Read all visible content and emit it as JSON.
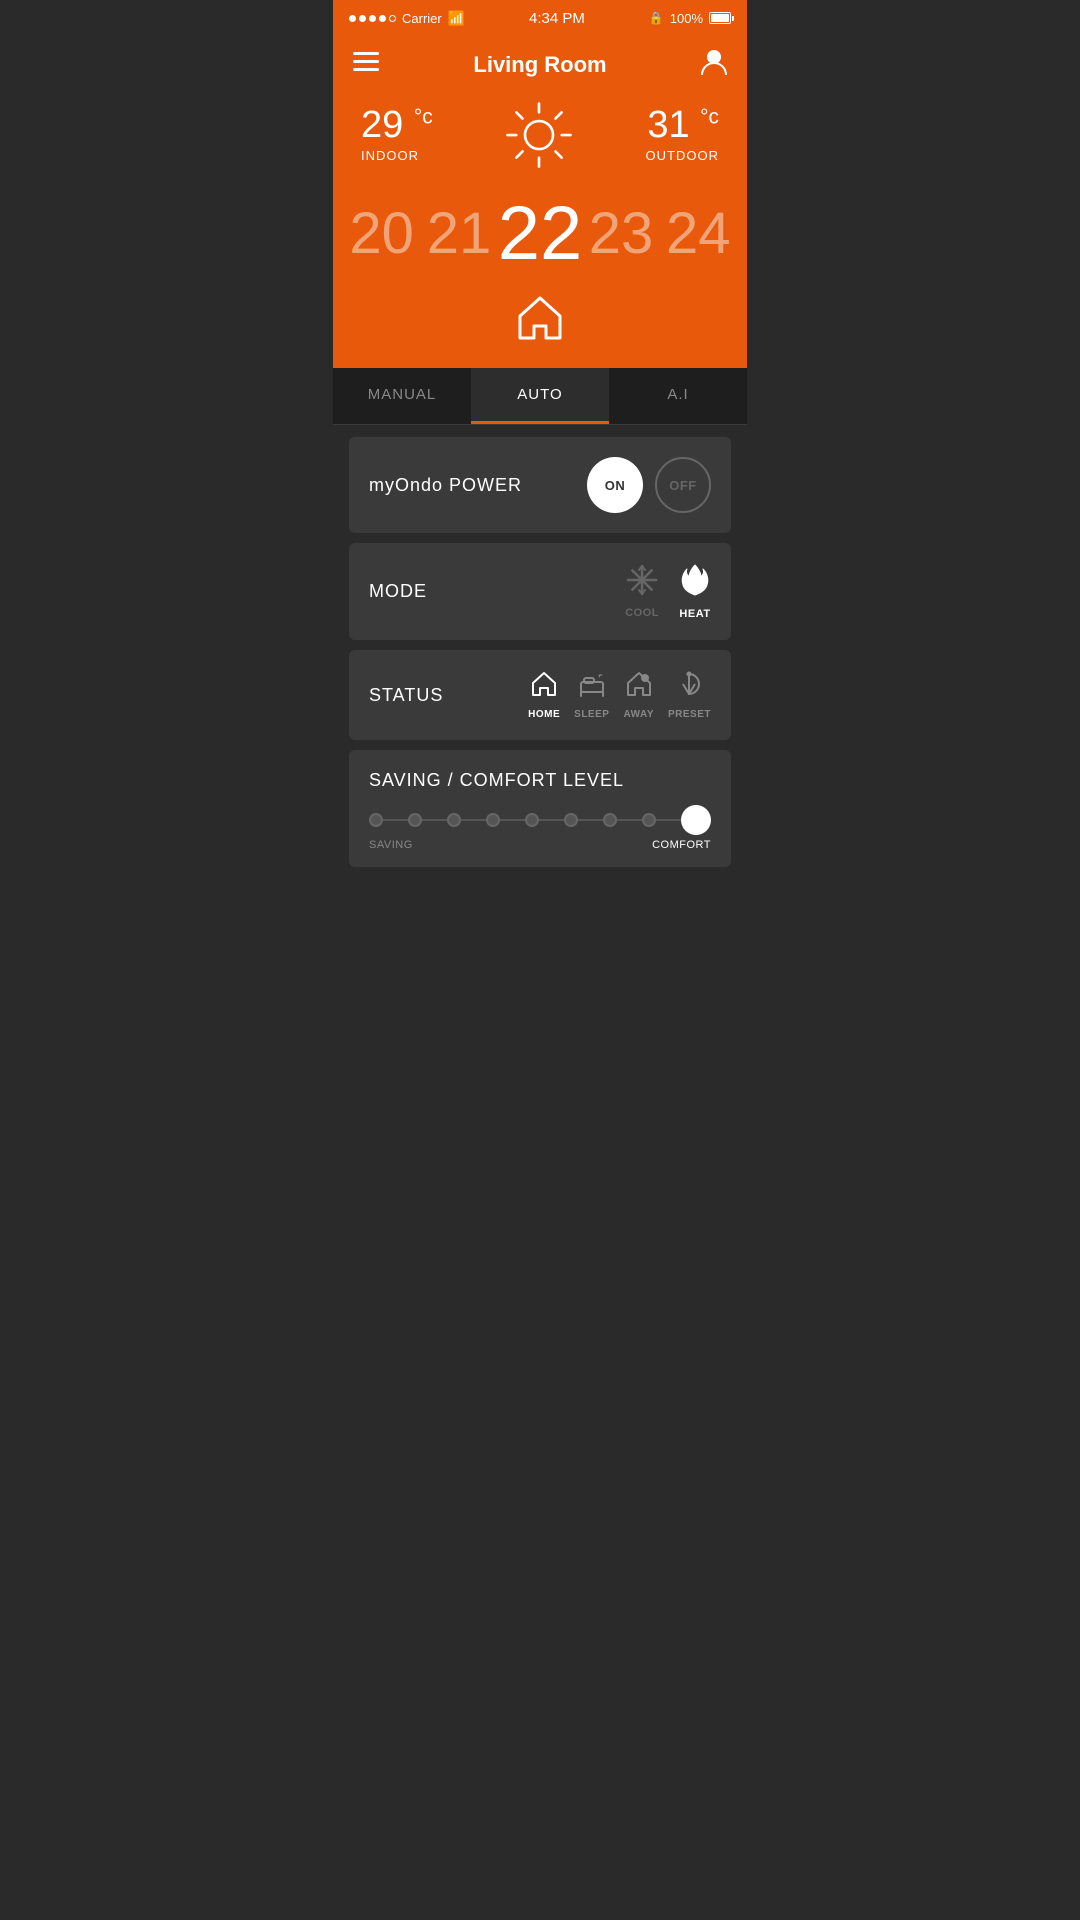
{
  "statusBar": {
    "carrier": "Carrier",
    "time": "4:34 PM",
    "battery": "100%"
  },
  "header": {
    "title": "Living Room"
  },
  "weather": {
    "indoor_temp": "29",
    "indoor_label": "INDOOR",
    "outdoor_temp": "31",
    "outdoor_label": "OUTDOOR",
    "unit": "°c"
  },
  "tempPicker": {
    "values": [
      "20",
      "21",
      "22",
      "23",
      "24"
    ],
    "activeIndex": 2
  },
  "tabs": [
    {
      "label": "MANUAL",
      "active": false
    },
    {
      "label": "AUTO",
      "active": true
    },
    {
      "label": "A.I",
      "active": false
    }
  ],
  "powerSection": {
    "label": "myOndo POWER",
    "onLabel": "ON",
    "offLabel": "OFF",
    "state": "on"
  },
  "modeSection": {
    "label": "MODE",
    "options": [
      {
        "label": "COOL",
        "active": false
      },
      {
        "label": "HEAT",
        "active": true
      }
    ]
  },
  "statusSection": {
    "label": "STATUS",
    "options": [
      {
        "label": "HOME",
        "active": true
      },
      {
        "label": "SLEEP",
        "active": false
      },
      {
        "label": "AWAY",
        "active": false
      },
      {
        "label": "PRESET",
        "active": false
      }
    ]
  },
  "savingSection": {
    "label": "SAVING / COMFORT LEVEL",
    "sublabels": [
      "SAVING",
      "COMFORT"
    ],
    "activePosition": 8,
    "totalDots": 9
  }
}
